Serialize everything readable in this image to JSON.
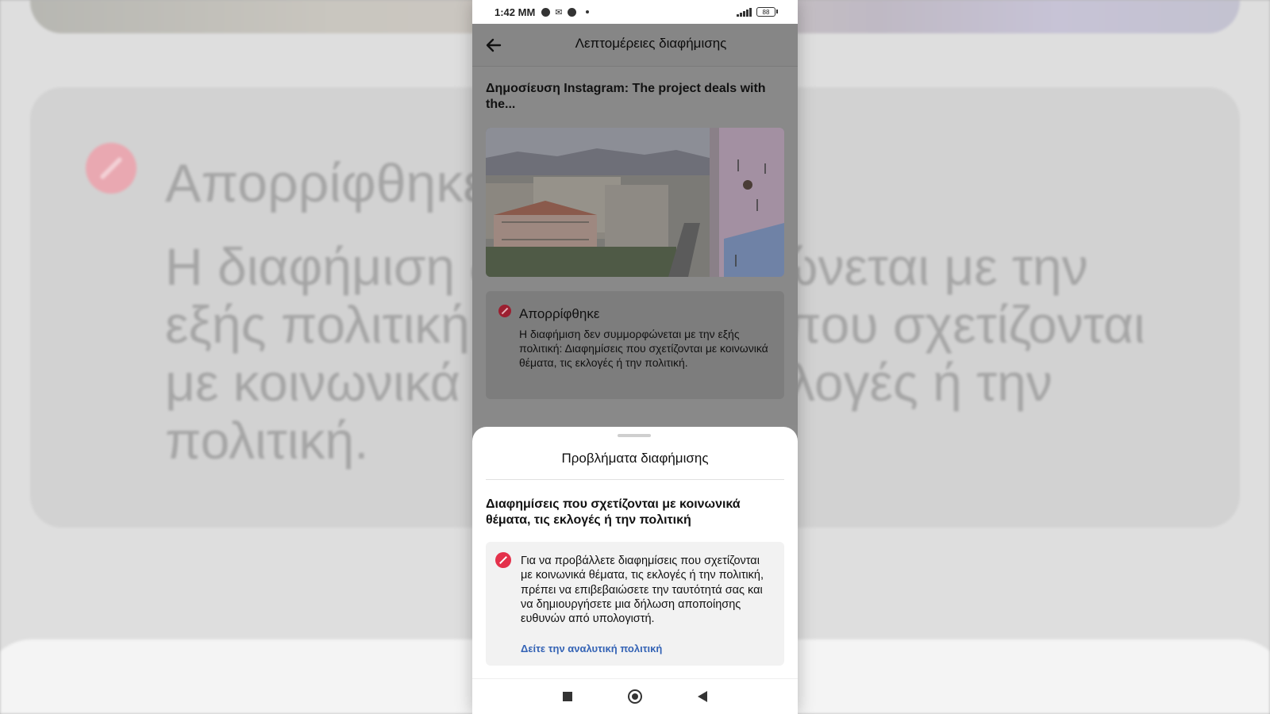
{
  "status_bar": {
    "time": "1:42 MM",
    "battery": "88"
  },
  "app_bar": {
    "title": "Λεπτομέρειες διαφήμισης"
  },
  "post": {
    "title": "Δημοσίευση Instagram: The project deals with the..."
  },
  "ad_status": {
    "label": "Απορρίφθηκε",
    "description": "Η διαφήμιση δεν συμμορφώνεται με την εξής πολιτική: Διαφημίσεις που σχετίζονται με κοινωνικά θέματα, τις εκλογές ή την πολιτική."
  },
  "sheet": {
    "title": "Προβλήματα διαφήμισης",
    "section_title": "Διαφημίσεις που σχετίζονται με κοινωνικά θέματα, τις εκλογές ή την πολιτική",
    "issue_text": "Για να προβάλλετε διαφημίσεις που σχετίζονται με κοινωνικά θέματα, τις εκλογές ή την πολιτική, πρέπει να επιβεβαιώσετε την ταυτότητά σας και να δημιουργήσετε μια δήλωση αποποίησης ευθυνών από υπολογιστή.",
    "issue_link": "Δείτε την αναλυτική πολιτική"
  },
  "background_zoom": {
    "status": "Απορρίφθηκε",
    "text": "Η διαφήμιση δεν συμμορφώνεται με την εξής πολιτική: Διαφημίσεις που σχετίζονται με κοινωνικά θέματα, τις εκλογές ή την πολιτική."
  },
  "colors": {
    "reject_red": "#e4314b",
    "link_blue": "#3463b5",
    "scrim": "#898989"
  },
  "icons": {
    "back": "arrow-left-icon",
    "status": "ban-icon",
    "nav": [
      "square-icon",
      "circle-home-icon",
      "triangle-back-icon"
    ]
  }
}
